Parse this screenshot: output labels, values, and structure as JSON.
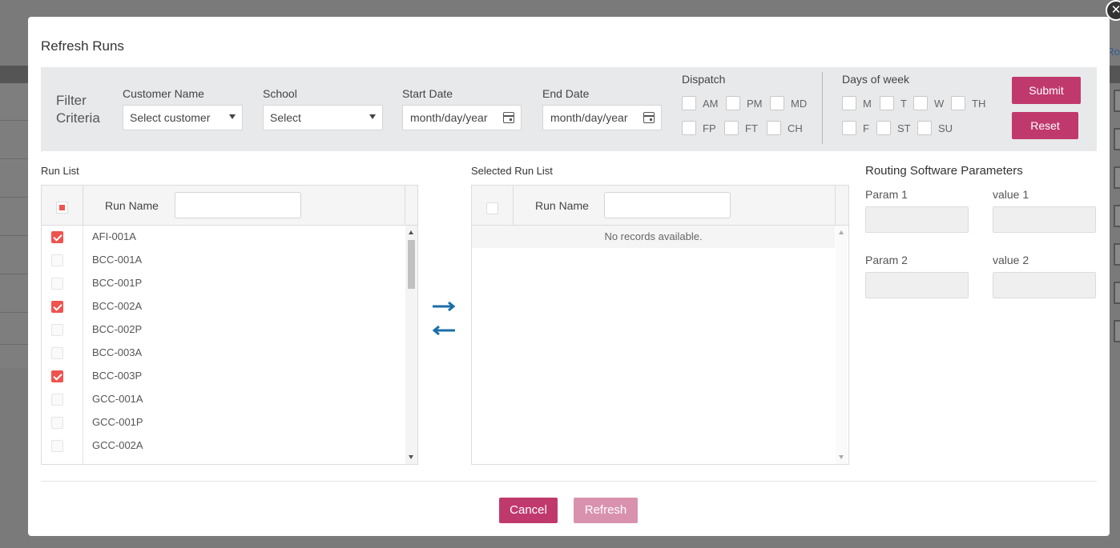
{
  "dialog": {
    "title": "Refresh Runs",
    "close_icon": "close-icon"
  },
  "background": {
    "partial_link": "Ro"
  },
  "filter": {
    "label": "Filter Criteria",
    "customer": {
      "label": "Customer Name",
      "value": "Select customer"
    },
    "school": {
      "label": "School",
      "value": "Select"
    },
    "start_date": {
      "label": "Start Date",
      "placeholder": "month/day/year"
    },
    "end_date": {
      "label": "End Date",
      "placeholder": "month/day/year"
    },
    "dispatch": {
      "label": "Dispatch",
      "options": [
        "AM",
        "PM",
        "MD",
        "FP",
        "FT",
        "CH"
      ]
    },
    "days_of_week": {
      "label": "Days of week",
      "options": [
        "M",
        "T",
        "W",
        "TH",
        "F",
        "ST",
        "SU"
      ]
    },
    "submit_label": "Submit",
    "reset_label": "Reset"
  },
  "run_list": {
    "title": "Run List",
    "column_header": "Run Name",
    "rows": [
      {
        "name": "AFI-001A",
        "checked": true
      },
      {
        "name": "BCC-001A",
        "checked": false
      },
      {
        "name": "BCC-001P",
        "checked": false
      },
      {
        "name": "BCC-002A",
        "checked": true
      },
      {
        "name": "BCC-002P",
        "checked": false
      },
      {
        "name": "BCC-003A",
        "checked": false
      },
      {
        "name": "BCC-003P",
        "checked": true
      },
      {
        "name": "GCC-001A",
        "checked": false
      },
      {
        "name": "GCC-001P",
        "checked": false
      },
      {
        "name": "GCC-002A",
        "checked": false
      }
    ]
  },
  "selected_run_list": {
    "title": "Selected Run List",
    "column_header": "Run Name",
    "empty_message": "No records available."
  },
  "routing_params": {
    "title": "Routing Software Parameters",
    "param1_label": "Param 1",
    "value1_label": "value 1",
    "param2_label": "Param 2",
    "value2_label": "value 2"
  },
  "footer": {
    "cancel_label": "Cancel",
    "refresh_label": "Refresh"
  },
  "colors": {
    "accent": "#c0396d",
    "accent_disabled": "#d992ad",
    "check_on": "#ef5350",
    "arrow": "#1a6fa8"
  }
}
